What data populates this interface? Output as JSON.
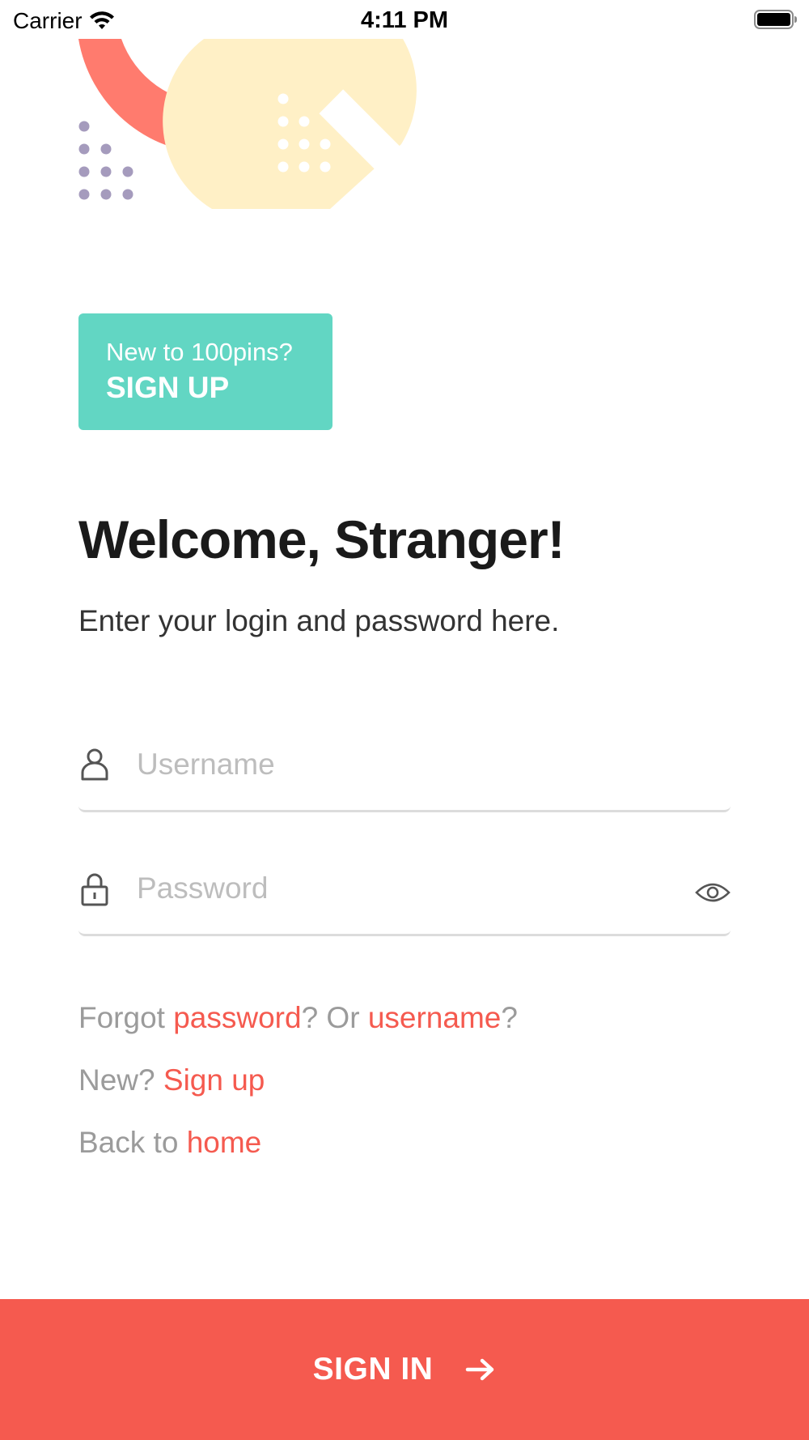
{
  "status_bar": {
    "carrier": "Carrier",
    "time": "4:11 PM"
  },
  "promo": {
    "line1": "New to 100pins?",
    "line2": "SIGN UP"
  },
  "welcome": {
    "title": "Welcome, Stranger!",
    "subtitle": "Enter your login and password here."
  },
  "form": {
    "username_placeholder": "Username",
    "password_placeholder": "Password"
  },
  "links": {
    "forgot_prefix": "Forgot ",
    "forgot_password": "password",
    "forgot_mid": "? Or ",
    "forgot_username": "username",
    "forgot_suffix": "?",
    "new_prefix": "New? ",
    "new_link": "Sign up",
    "back_prefix": "Back to ",
    "back_link": "home"
  },
  "signin": {
    "label": "SIGN IN"
  },
  "colors": {
    "accent": "#f55a4f",
    "promo": "#62d6c3",
    "art_coral": "#ff7b6e",
    "art_yellow": "#fff0c6",
    "art_dots": "#a59bbd"
  },
  "icons": {
    "wifi": "wifi-icon",
    "battery": "battery-icon",
    "user": "user-icon",
    "lock": "lock-icon",
    "eye": "eye-icon",
    "arrow": "arrow-right-icon"
  }
}
